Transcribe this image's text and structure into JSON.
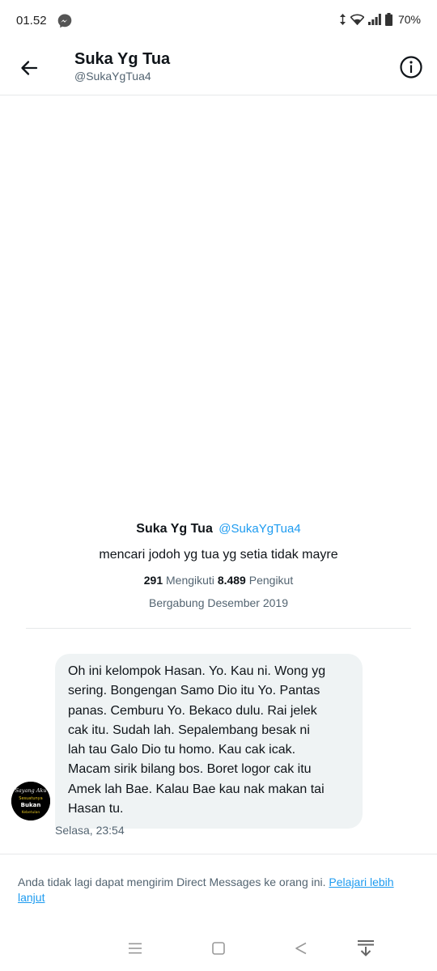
{
  "status_bar": {
    "time": "01.52",
    "battery": "70%",
    "icons": [
      "messenger-icon",
      "data-arrows-icon",
      "wifi-icon",
      "signal-icon",
      "battery-icon"
    ]
  },
  "header": {
    "name": "Suka Yg Tua",
    "handle": "@SukaYgTua4",
    "back_icon": "arrow-left-icon",
    "info_icon": "info-icon"
  },
  "profile": {
    "name": "Suka Yg Tua",
    "handle": "@SukaYgTua4",
    "bio": "mencari jodoh yg tua yg setia tidak mayre",
    "following_count": "291",
    "following_label": "Mengikuti",
    "followers_count": "8.489",
    "followers_label": "Pengikut",
    "joined": "Bergabung Desember 2019"
  },
  "message": {
    "lines": [
      "Oh ini kelompok Hasan. Yo.  Kau ni. Wong yg",
      "sering. Bongengan Samo Dio itu Yo.  Pantas",
      "panas.  Cemburu Yo.   Bekaco dulu. Rai jelek",
      "cak itu.     Sudah lah. Sepalembang besak ni",
      "lah tau Galo Dio tu homo. Kau cak icak.",
      "Macam sirik bilang bos.  Boret logor cak itu",
      "Amek lah Bae. Kalau Bae kau nak makan tai",
      "Hasan tu."
    ],
    "time": "Selasa, 23:54",
    "avatar_lines": [
      "Sayang Aku",
      "Sesuatunya",
      "Bukan",
      "Kebetulan"
    ]
  },
  "notice": {
    "text": "Anda tidak lagi dapat mengirim Direct Messages ke orang ini. ",
    "link": "Pelajari lebih lanjut"
  },
  "colors": {
    "accent": "#1d9bf0",
    "text_primary": "#0f1419",
    "text_secondary": "#536471",
    "bubble_bg": "#eff3f4"
  }
}
